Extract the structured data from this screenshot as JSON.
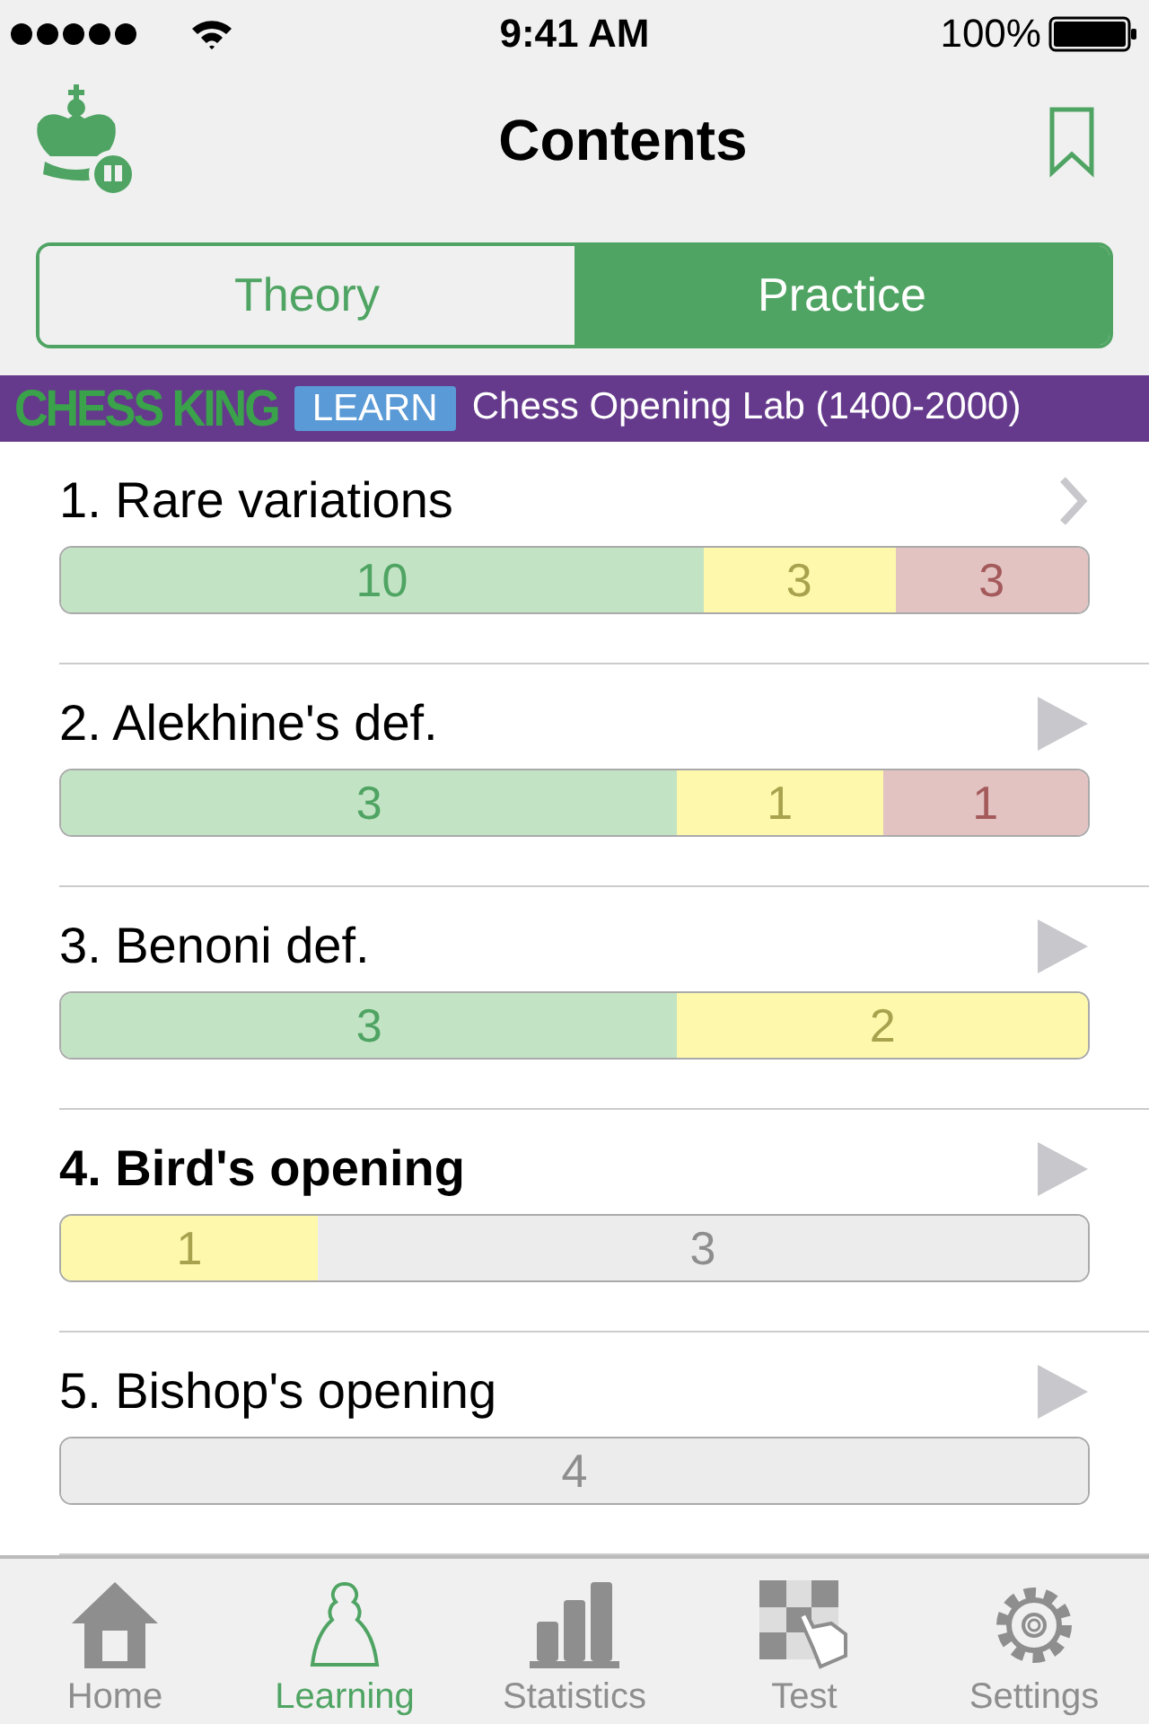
{
  "status_bar": {
    "time": "9:41 AM",
    "battery": "100%"
  },
  "header": {
    "title": "Contents"
  },
  "tabs": [
    {
      "label": "Theory",
      "selected": false
    },
    {
      "label": "Practice",
      "selected": true
    }
  ],
  "banner": {
    "brand": "CHESS KING",
    "badge": "LEARN",
    "course": "Chess Opening Lab (1400-2000)"
  },
  "chapters": [
    {
      "title": "1. Rare variations",
      "selected": false,
      "kind": "chevron",
      "segments": [
        {
          "kind": "solved",
          "count": "10"
        },
        {
          "kind": "partial",
          "count": "3"
        },
        {
          "kind": "failed",
          "count": "3"
        }
      ]
    },
    {
      "title": "2. Alekhine's def.",
      "selected": false,
      "kind": "play",
      "segments": [
        {
          "kind": "solved",
          "count": "3"
        },
        {
          "kind": "partial",
          "count": "1"
        },
        {
          "kind": "failed",
          "count": "1"
        }
      ]
    },
    {
      "title": "3. Benoni def.",
      "selected": false,
      "kind": "play",
      "segments": [
        {
          "kind": "solved",
          "count": "3"
        },
        {
          "kind": "partial",
          "count": "2"
        }
      ]
    },
    {
      "title": "4. Bird's opening",
      "selected": true,
      "kind": "play",
      "segments": [
        {
          "kind": "partial",
          "count": "1"
        },
        {
          "kind": "unsolved",
          "count": "3"
        }
      ]
    },
    {
      "title": "5. Bishop's opening",
      "selected": false,
      "kind": "play",
      "segments": [
        {
          "kind": "unsolved",
          "count": "4"
        }
      ]
    }
  ],
  "tab_bar": [
    {
      "label": "Home",
      "selected": false,
      "kind": "home"
    },
    {
      "label": "Learning",
      "selected": true,
      "kind": "pawn"
    },
    {
      "label": "Statistics",
      "selected": false,
      "kind": "stats"
    },
    {
      "label": "Test",
      "selected": false,
      "kind": "test"
    },
    {
      "label": "Settings",
      "selected": false,
      "kind": "settings"
    }
  ]
}
